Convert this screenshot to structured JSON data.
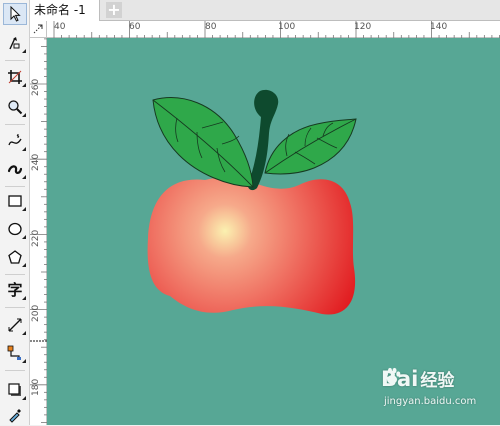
{
  "document_tab": {
    "label": "未命名 -1",
    "add_tab_symbol": "+"
  },
  "ruler": {
    "horizontal_labels": [
      "40",
      "60",
      "80",
      "100",
      "120",
      "140"
    ],
    "vertical_labels": [
      "260",
      "240",
      "220",
      "200",
      "180"
    ]
  },
  "toolbox": {
    "tools": [
      {
        "name": "pick-tool",
        "icon": "cursor-arrow-icon"
      },
      {
        "name": "shape-tool",
        "icon": "shape-edit-icon"
      },
      {
        "name": "crop-tool",
        "icon": "crop-icon"
      },
      {
        "name": "zoom-tool",
        "icon": "magnifier-icon"
      },
      {
        "name": "freehand-tool",
        "icon": "freehand-curve-icon"
      },
      {
        "name": "artistic-media-tool",
        "icon": "brush-stroke-icon"
      },
      {
        "name": "rectangle-tool",
        "icon": "rectangle-icon"
      },
      {
        "name": "ellipse-tool",
        "icon": "ellipse-icon"
      },
      {
        "name": "polygon-tool",
        "icon": "polygon-icon"
      },
      {
        "name": "text-tool",
        "icon": "text-icon",
        "label": "字"
      },
      {
        "name": "dimension-tool",
        "icon": "dimension-line-icon"
      },
      {
        "name": "connector-tool",
        "icon": "connector-icon"
      },
      {
        "name": "drop-shadow-tool",
        "icon": "drop-shadow-icon"
      },
      {
        "name": "eyedropper-tool",
        "icon": "eyedropper-icon"
      }
    ]
  },
  "canvas": {
    "background_color": "#57a795",
    "apple_colors": {
      "body_center": "#fbf1b0",
      "body_mid": "#ef7c6c",
      "body_edge": "#e0141a",
      "leaf": "#2fa84a",
      "stem": "#0e4a2e"
    }
  },
  "watermark": {
    "logo_text_left": "Bai",
    "logo_text_right": "经验",
    "url": "jingyan.baidu.com"
  }
}
